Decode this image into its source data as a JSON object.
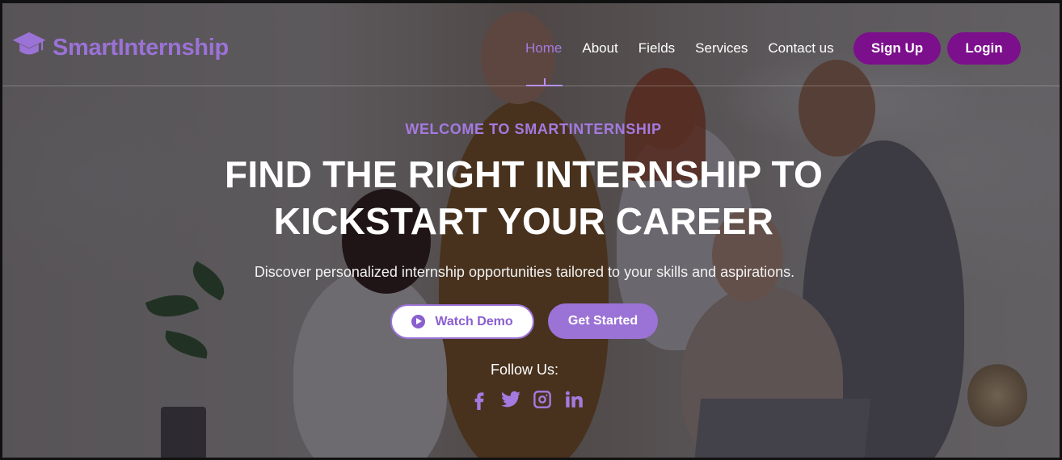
{
  "brand": {
    "name": "SmartInternship",
    "icon": "graduation-cap-icon",
    "color": "#9b72d6"
  },
  "nav": {
    "items": [
      {
        "label": "Home",
        "active": true
      },
      {
        "label": "About"
      },
      {
        "label": "Fields"
      },
      {
        "label": "Services"
      },
      {
        "label": "Contact us"
      }
    ],
    "signup_label": "Sign Up",
    "login_label": "Login",
    "button_color": "#7c0f8c"
  },
  "hero": {
    "eyebrow": "WELCOME TO SMARTINTERNSHIP",
    "headline": "FIND THE RIGHT INTERNSHIP TO KICKSTART YOUR CAREER",
    "subtext": "Discover personalized internship opportunities tailored to your skills and aspirations.",
    "watch_demo_label": "Watch Demo",
    "get_started_label": "Get Started",
    "follow_label": "Follow Us:",
    "socials": [
      "facebook-icon",
      "twitter-icon",
      "instagram-icon",
      "linkedin-icon"
    ],
    "accent_color": "#a57ae0"
  }
}
